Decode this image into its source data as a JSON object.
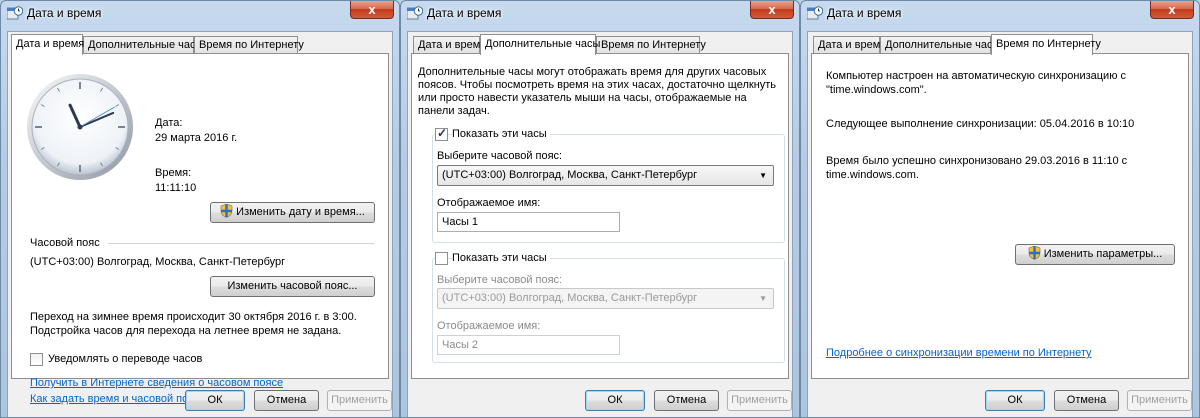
{
  "window_title": "Дата и время",
  "close_symbol": "x",
  "tabs": [
    "Дата и время",
    "Дополнительные часы",
    "Время по Интернету"
  ],
  "footer": {
    "ok": "ОК",
    "cancel": "Отмена",
    "apply": "Применить"
  },
  "panel1": {
    "date_label": "Дата:",
    "date_value": "29 марта 2016 г.",
    "time_label": "Время:",
    "time_value": "11:11:10",
    "change_datetime_button": "Изменить дату и время...",
    "timezone_heading": "Часовой пояс",
    "timezone_value": "(UTC+03:00) Волгоград, Москва, Санкт-Петербург",
    "change_timezone_button": "Изменить часовой пояс...",
    "dst_line1": "Переход на зимнее время происходит 30 октября 2016 г. в 3:00.",
    "dst_line2": "Подстройка часов для перехода на летнее время не задана.",
    "notify_checkbox": "Уведомлять о переводе часов",
    "link_timezone_info": "Получить в Интернете сведения о часовом поясе",
    "link_how_to": "Как задать время и часовой пояс?",
    "clock": {
      "hour": 11,
      "minute": 11,
      "second": 10
    }
  },
  "panel2": {
    "intro_lines": [
      "Дополнительные часы могут отображать время для других часовых",
      "поясов. Чтобы посмотреть время на этих часах, достаточно щелкнуть",
      "или просто навести указатель мыши на часы, отображаемые на",
      "панели задач."
    ],
    "clock1": {
      "show_label": "Показать эти часы",
      "checked": true,
      "tz_label": "Выберите часовой пояс:",
      "tz_value": "(UTC+03:00) Волгоград, Москва, Санкт-Петербург",
      "name_label": "Отображаемое имя:",
      "name_value": "Часы 1"
    },
    "clock2": {
      "show_label": "Показать эти часы",
      "checked": false,
      "tz_label": "Выберите часовой пояс:",
      "tz_value": "(UTC+03:00) Волгоград, Москва, Санкт-Петербург",
      "name_label": "Отображаемое имя:",
      "name_value": "Часы 2"
    }
  },
  "panel3": {
    "sync_line1": "Компьютер настроен на автоматическую синхронизацию с",
    "sync_line2": "\"time.windows.com\".",
    "next_sync": "Следующее выполнение синхронизации: 05.04.2016 в 10:10",
    "last_sync_line1": "Время было успешно синхронизовано 29.03.2016 в 11:10 с",
    "last_sync_line2": "time.windows.com.",
    "change_settings_button": "Изменить параметры...",
    "link_more": "Подробнее о синхронизации времени по Интернету"
  }
}
